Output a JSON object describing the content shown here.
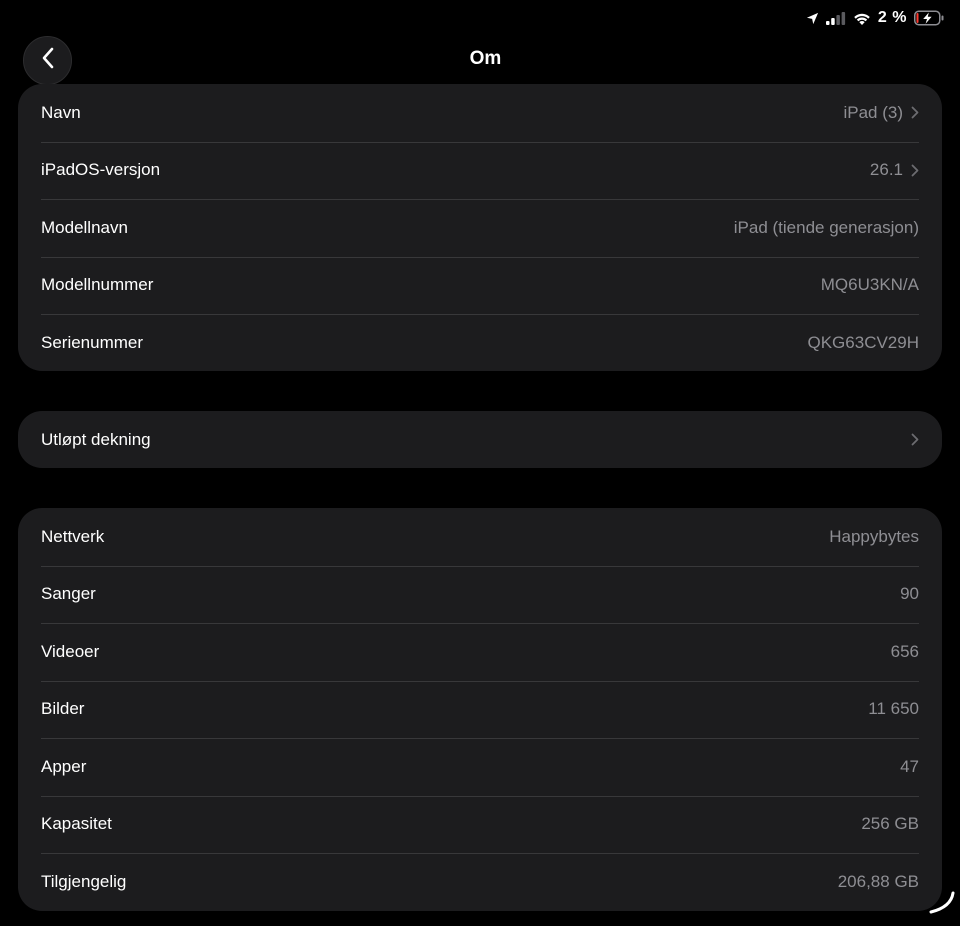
{
  "status_bar": {
    "battery_percent": "2 %"
  },
  "header": {
    "title": "Om"
  },
  "about_group": [
    {
      "label": "Navn",
      "value": "iPad (3)",
      "chevron": true
    },
    {
      "label": "iPadOS-versjon",
      "value": "26.1",
      "chevron": true
    },
    {
      "label": "Modellnavn",
      "value": "iPad (tiende generasjon)",
      "chevron": false
    },
    {
      "label": "Modellnummer",
      "value": "MQ6U3KN/A",
      "chevron": false
    },
    {
      "label": "Serienummer",
      "value": "QKG63CV29H",
      "chevron": false
    }
  ],
  "coverage_group": {
    "label": "Utløpt dekning"
  },
  "stats_group": [
    {
      "label": "Nettverk",
      "value": "Happybytes"
    },
    {
      "label": "Sanger",
      "value": "90"
    },
    {
      "label": "Videoer",
      "value": "656"
    },
    {
      "label": "Bilder",
      "value": "11 650"
    },
    {
      "label": "Apper",
      "value": "47"
    },
    {
      "label": "Kapasitet",
      "value": "256 GB"
    },
    {
      "label": "Tilgjengelig",
      "value": "206,88 GB"
    }
  ],
  "colors": {
    "background": "#000000",
    "group_background": "#1c1c1e",
    "secondary_text": "#8e8e93",
    "separator": "#38383a",
    "battery_low": "#ff3b30"
  },
  "icons": {
    "location": "location-arrow-icon",
    "signal": "cellular-signal-icon",
    "wifi": "wifi-icon",
    "battery": "battery-charging-icon",
    "back": "chevron-left-icon",
    "disclosure": "chevron-right-icon"
  }
}
